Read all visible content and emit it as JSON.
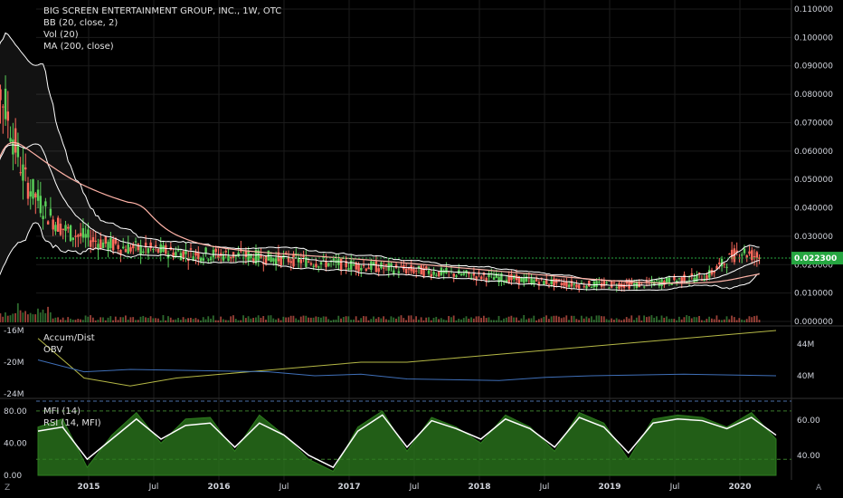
{
  "chart_data": {
    "type": "candlestick",
    "title": "BIG SCREEN ENTERTAINMENT GROUP, INC., 1W, OTC",
    "indicators": [
      "BB (20, close, 2)",
      "Vol (20)",
      "MA (200, close)"
    ],
    "x_ticks": [
      "2015",
      "Jul",
      "2016",
      "Jul",
      "2017",
      "Jul",
      "2018",
      "Jul",
      "2019",
      "Jul",
      "2020"
    ],
    "price_axis": {
      "ticks": [
        "0.110000",
        "0.100000",
        "0.090000",
        "0.080000",
        "0.070000",
        "0.060000",
        "0.050000",
        "0.040000",
        "0.030000",
        "0.020000",
        "0.010000",
        "0.000000"
      ],
      "range": [
        0.0,
        0.11
      ],
      "last_price_label": "0.022300",
      "last_price": 0.0223
    },
    "price_series": {
      "close_2014_2015": [
        0.031,
        0.05,
        0.085,
        0.075,
        0.062,
        0.05,
        0.045,
        0.04,
        0.036,
        0.033,
        0.031,
        0.03,
        0.029,
        0.028,
        0.027,
        0.027,
        0.026
      ],
      "close_2015_2020_points": [
        {
          "x": "2015-04",
          "y": 0.026
        },
        {
          "x": "2015-10",
          "y": 0.024
        },
        {
          "x": "2016-04",
          "y": 0.023
        },
        {
          "x": "2016-10",
          "y": 0.021
        },
        {
          "x": "2017-04",
          "y": 0.019
        },
        {
          "x": "2017-10",
          "y": 0.017
        },
        {
          "x": "2018-04",
          "y": 0.015
        },
        {
          "x": "2018-10",
          "y": 0.013
        },
        {
          "x": "2019-04",
          "y": 0.013
        },
        {
          "x": "2019-10",
          "y": 0.016
        },
        {
          "x": "2020-01",
          "y": 0.025
        },
        {
          "x": "2020-03",
          "y": 0.0223
        }
      ]
    },
    "accum_panel": {
      "labels": [
        "Accum/Dist",
        "OBV"
      ],
      "left_ticks": [
        "-16M",
        "-20M",
        "-24M"
      ],
      "right_ticks": [
        "44M",
        "40M"
      ],
      "series": [
        {
          "name": "Accum/Dist",
          "color": "#b5b846",
          "values": [
            -17,
            -22,
            -23,
            -22,
            -21.5,
            -21,
            -20.5,
            -20,
            -20,
            -19.5,
            -19,
            -18.5,
            -18,
            -17.5,
            -17,
            -16.5,
            -16
          ]
        },
        {
          "name": "OBV",
          "color": "#3f6fb8",
          "values": [
            42,
            40.5,
            40.8,
            40.7,
            40.6,
            40.5,
            40,
            40.2,
            39.6,
            39.5,
            39.4,
            39.8,
            40,
            40.1,
            40.2,
            40.1,
            40
          ]
        }
      ]
    },
    "osc_panel": {
      "labels": [
        "MFI (14)",
        "RSI (14, MFI)"
      ],
      "left_ticks": [
        "80.00",
        "40.00",
        "0.00"
      ],
      "right_ticks": [
        "60.00",
        "40.00"
      ],
      "levels": [
        80,
        20
      ],
      "series": [
        {
          "name": "MFI (14)",
          "color": "#2e7d1f",
          "values": [
            60,
            70,
            10,
            50,
            78,
            40,
            70,
            72,
            30,
            75,
            50,
            20,
            5,
            60,
            80,
            30,
            72,
            60,
            40,
            75,
            60,
            30,
            78,
            65,
            20,
            70,
            75,
            72,
            60,
            78,
            45
          ]
        },
        {
          "name": "RSI (14, MFI)",
          "color": "#ffffff",
          "values": [
            55,
            60,
            20,
            45,
            70,
            45,
            62,
            65,
            35,
            65,
            50,
            25,
            10,
            55,
            75,
            35,
            68,
            58,
            45,
            70,
            58,
            35,
            72,
            60,
            28,
            65,
            70,
            68,
            58,
            72,
            50
          ]
        }
      ]
    },
    "colors": {
      "background": "#000000",
      "up": "#5ad15a",
      "down": "#ff6a5c",
      "bands": "#ffffff",
      "ma": "#ffb3a7",
      "grid": "#1b1b1b",
      "last_price_bg": "#26a641"
    }
  },
  "ui": {
    "bottom_left_glyph": "Z",
    "bottom_right_glyph": "A"
  }
}
